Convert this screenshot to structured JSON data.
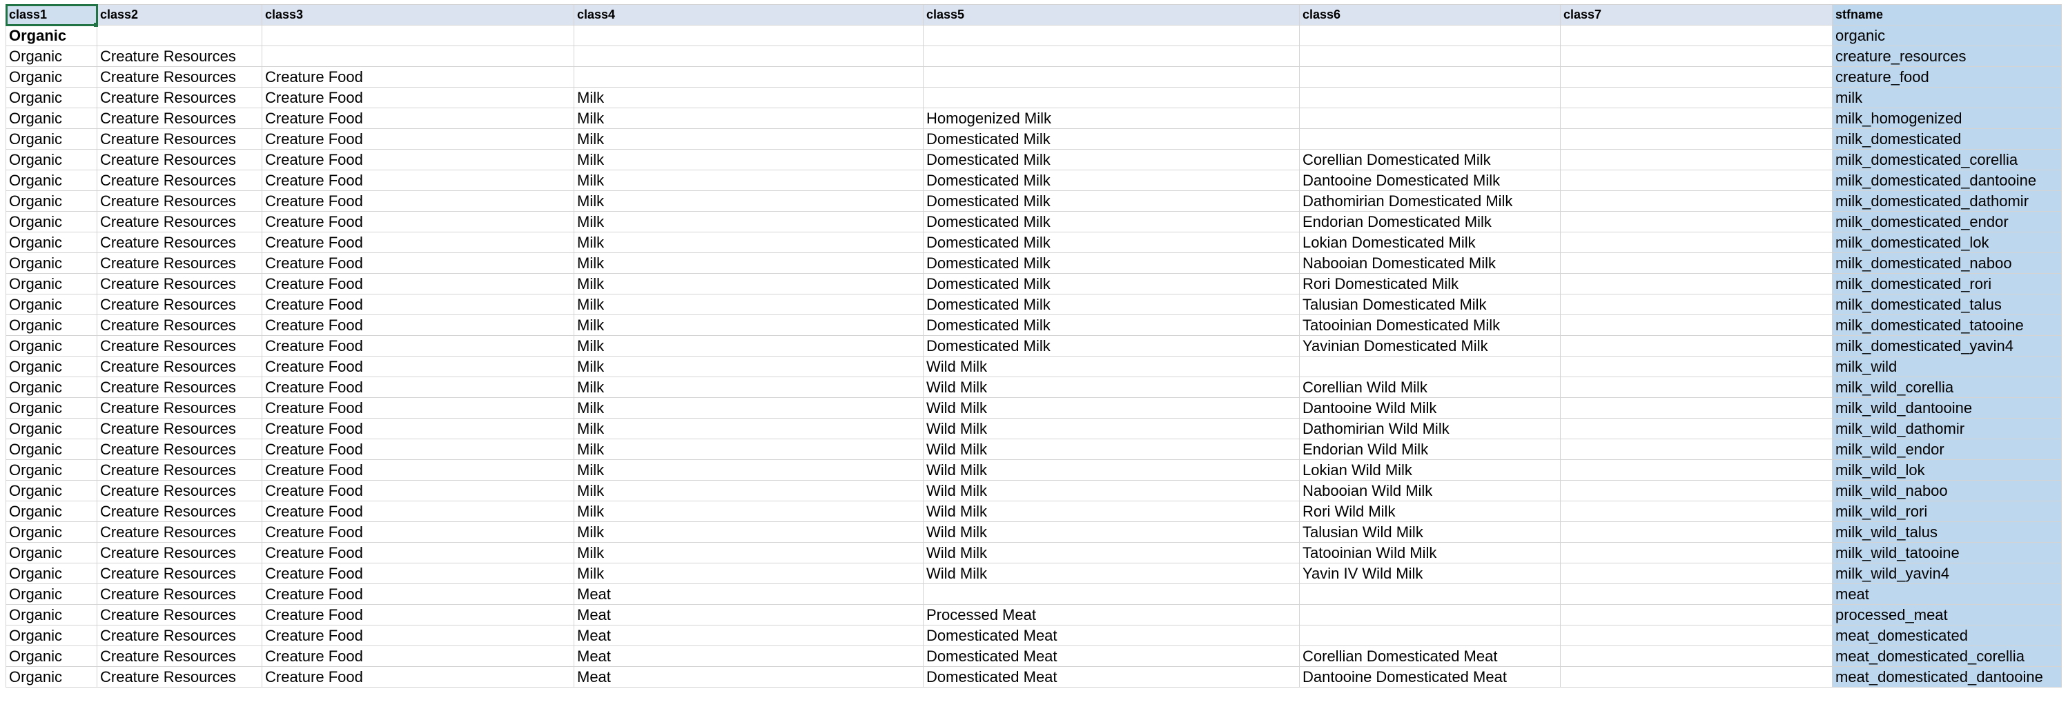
{
  "sheet": {
    "headers": [
      "class1",
      "class2",
      "class3",
      "class4",
      "class5",
      "class6",
      "class7",
      "stfname"
    ],
    "rows": [
      [
        "Organic",
        "",
        "",
        "",
        "",
        "",
        "",
        "organic"
      ],
      [
        "Organic",
        "Creature Resources",
        "",
        "",
        "",
        "",
        "",
        "creature_resources"
      ],
      [
        "Organic",
        "Creature Resources",
        "Creature Food",
        "",
        "",
        "",
        "",
        "creature_food"
      ],
      [
        "Organic",
        "Creature Resources",
        "Creature Food",
        "Milk",
        "",
        "",
        "",
        "milk"
      ],
      [
        "Organic",
        "Creature Resources",
        "Creature Food",
        "Milk",
        "Homogenized Milk",
        "",
        "",
        "milk_homogenized"
      ],
      [
        "Organic",
        "Creature Resources",
        "Creature Food",
        "Milk",
        "Domesticated Milk",
        "",
        "",
        "milk_domesticated"
      ],
      [
        "Organic",
        "Creature Resources",
        "Creature Food",
        "Milk",
        "Domesticated Milk",
        "Corellian Domesticated Milk",
        "",
        "milk_domesticated_corellia"
      ],
      [
        "Organic",
        "Creature Resources",
        "Creature Food",
        "Milk",
        "Domesticated Milk",
        "Dantooine Domesticated Milk",
        "",
        "milk_domesticated_dantooine"
      ],
      [
        "Organic",
        "Creature Resources",
        "Creature Food",
        "Milk",
        "Domesticated Milk",
        "Dathomirian Domesticated Milk",
        "",
        "milk_domesticated_dathomir"
      ],
      [
        "Organic",
        "Creature Resources",
        "Creature Food",
        "Milk",
        "Domesticated Milk",
        "Endorian Domesticated Milk",
        "",
        "milk_domesticated_endor"
      ],
      [
        "Organic",
        "Creature Resources",
        "Creature Food",
        "Milk",
        "Domesticated Milk",
        "Lokian Domesticated Milk",
        "",
        "milk_domesticated_lok"
      ],
      [
        "Organic",
        "Creature Resources",
        "Creature Food",
        "Milk",
        "Domesticated Milk",
        "Nabooian Domesticated Milk",
        "",
        "milk_domesticated_naboo"
      ],
      [
        "Organic",
        "Creature Resources",
        "Creature Food",
        "Milk",
        "Domesticated Milk",
        "Rori Domesticated Milk",
        "",
        "milk_domesticated_rori"
      ],
      [
        "Organic",
        "Creature Resources",
        "Creature Food",
        "Milk",
        "Domesticated Milk",
        "Talusian Domesticated Milk",
        "",
        "milk_domesticated_talus"
      ],
      [
        "Organic",
        "Creature Resources",
        "Creature Food",
        "Milk",
        "Domesticated Milk",
        "Tatooinian Domesticated Milk",
        "",
        "milk_domesticated_tatooine"
      ],
      [
        "Organic",
        "Creature Resources",
        "Creature Food",
        "Milk",
        "Domesticated Milk",
        "Yavinian Domesticated Milk",
        "",
        "milk_domesticated_yavin4"
      ],
      [
        "Organic",
        "Creature Resources",
        "Creature Food",
        "Milk",
        "Wild Milk",
        "",
        "",
        "milk_wild"
      ],
      [
        "Organic",
        "Creature Resources",
        "Creature Food",
        "Milk",
        "Wild Milk",
        "Corellian Wild Milk",
        "",
        "milk_wild_corellia"
      ],
      [
        "Organic",
        "Creature Resources",
        "Creature Food",
        "Milk",
        "Wild Milk",
        "Dantooine Wild Milk",
        "",
        "milk_wild_dantooine"
      ],
      [
        "Organic",
        "Creature Resources",
        "Creature Food",
        "Milk",
        "Wild Milk",
        "Dathomirian Wild Milk",
        "",
        "milk_wild_dathomir"
      ],
      [
        "Organic",
        "Creature Resources",
        "Creature Food",
        "Milk",
        "Wild Milk",
        "Endorian Wild Milk",
        "",
        "milk_wild_endor"
      ],
      [
        "Organic",
        "Creature Resources",
        "Creature Food",
        "Milk",
        "Wild Milk",
        "Lokian Wild Milk",
        "",
        "milk_wild_lok"
      ],
      [
        "Organic",
        "Creature Resources",
        "Creature Food",
        "Milk",
        "Wild Milk",
        "Nabooian Wild Milk",
        "",
        "milk_wild_naboo"
      ],
      [
        "Organic",
        "Creature Resources",
        "Creature Food",
        "Milk",
        "Wild Milk",
        "Rori Wild Milk",
        "",
        "milk_wild_rori"
      ],
      [
        "Organic",
        "Creature Resources",
        "Creature Food",
        "Milk",
        "Wild Milk",
        "Talusian Wild Milk",
        "",
        "milk_wild_talus"
      ],
      [
        "Organic",
        "Creature Resources",
        "Creature Food",
        "Milk",
        "Wild Milk",
        "Tatooinian Wild Milk",
        "",
        "milk_wild_tatooine"
      ],
      [
        "Organic",
        "Creature Resources",
        "Creature Food",
        "Milk",
        "Wild Milk",
        "Yavin IV Wild Milk",
        "",
        "milk_wild_yavin4"
      ],
      [
        "Organic",
        "Creature Resources",
        "Creature Food",
        "Meat",
        "",
        "",
        "",
        "meat"
      ],
      [
        "Organic",
        "Creature Resources",
        "Creature Food",
        "Meat",
        "Processed Meat",
        "",
        "",
        "processed_meat"
      ],
      [
        "Organic",
        "Creature Resources",
        "Creature Food",
        "Meat",
        "Domesticated Meat",
        "",
        "",
        "meat_domesticated"
      ],
      [
        "Organic",
        "Creature Resources",
        "Creature Food",
        "Meat",
        "Domesticated Meat",
        "Corellian Domesticated Meat",
        "",
        "meat_domesticated_corellia"
      ],
      [
        "Organic",
        "Creature Resources",
        "Creature Food",
        "Meat",
        "Domesticated Meat",
        "Dantooine Domesticated Meat",
        "",
        "meat_domesticated_dantooine"
      ]
    ]
  }
}
